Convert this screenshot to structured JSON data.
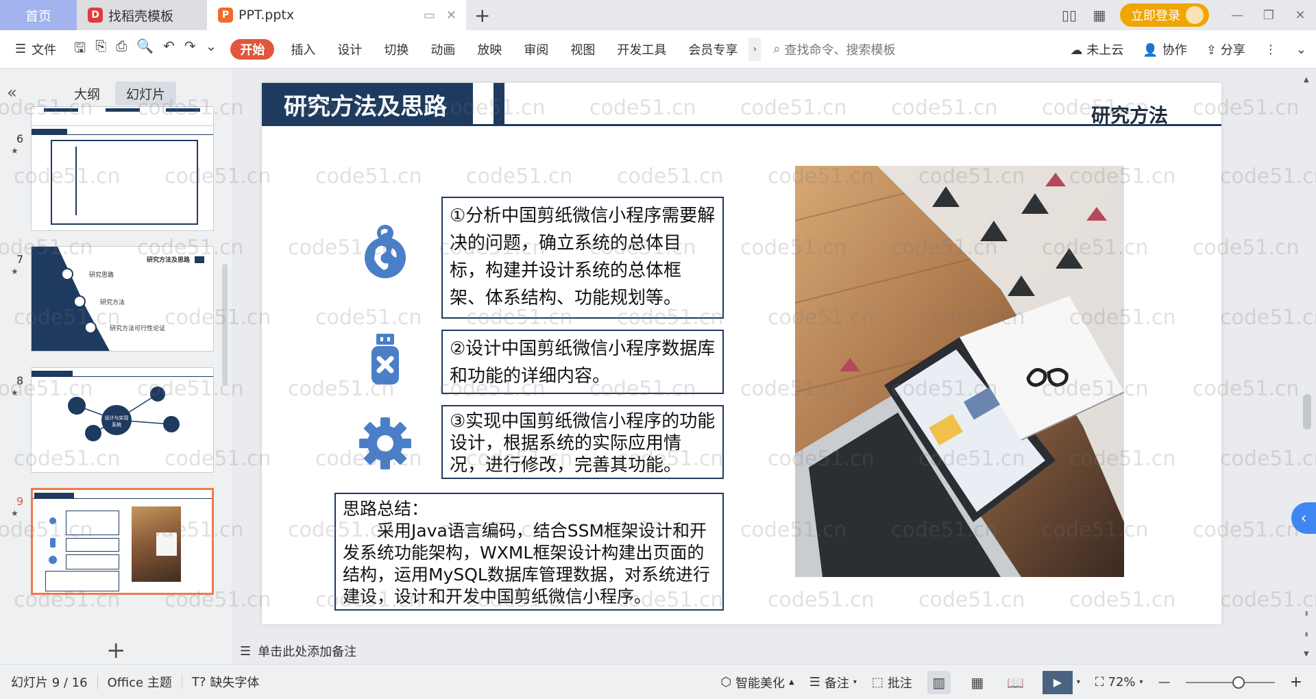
{
  "titlebar": {
    "tabs": [
      {
        "label": "首页"
      },
      {
        "label": "找稻壳模板"
      },
      {
        "label": "PPT.pptx"
      }
    ],
    "login_label": "立即登录"
  },
  "ribbon": {
    "file_label": "文件",
    "menu_tabs": [
      "开始",
      "插入",
      "设计",
      "切换",
      "动画",
      "放映",
      "审阅",
      "视图",
      "开发工具",
      "会员专享"
    ],
    "search_placeholder": "查找命令、搜索模板",
    "cloud_label": "未上云",
    "collab_label": "协作",
    "share_label": "分享"
  },
  "leftpanel": {
    "tabs": [
      "大纲",
      "幻灯片"
    ],
    "active_tab": "幻灯片",
    "thumbs": [
      {
        "num": "6"
      },
      {
        "num": "7",
        "items": [
          "研究思路",
          "研究方法",
          "研究方法可行性论证"
        ],
        "title": "研究方法及思路"
      },
      {
        "num": "8",
        "center": "设计与实现系统"
      },
      {
        "num": "9",
        "selected": true
      }
    ]
  },
  "slide": {
    "title": "研究方法及思路",
    "subtitle": "研究方法",
    "boxes": [
      "①分析中国剪纸微信小程序需要解决的问题，确立系统的总体目标，构建并设计系统的总体框架、体系结构、功能规划等。",
      "②设计中国剪纸微信小程序数据库和功能的详细内容。",
      "③实现中国剪纸微信小程序的功能设计，根据系统的实际应用情况，进行修改，完善其功能。"
    ],
    "summary_title": "思路总结：",
    "summary_body": "采用Java语言编码，结合SSM框架设计和开发系统功能架构，WXML框架设计构建出页面的结构，运用MySQL数据库管理数据，对系统进行建设，设计和开发中国剪纸微信小程序。",
    "icons": [
      "globe-icon",
      "usb-icon",
      "gear-icon"
    ]
  },
  "notes_placeholder": "单击此处添加备注",
  "statusbar": {
    "slide_counter": "幻灯片 9 / 16",
    "theme": "Office 主题",
    "missing_font": "缺失字体",
    "beautify": "智能美化",
    "notes": "备注",
    "comments": "批注",
    "zoom": "72%"
  },
  "watermark": "code51.cn",
  "colors": {
    "accent": "#e2563d",
    "slide_navy": "#1e3a5f",
    "icon_blue": "#4a7fc7",
    "login_orange": "#f0a500"
  }
}
